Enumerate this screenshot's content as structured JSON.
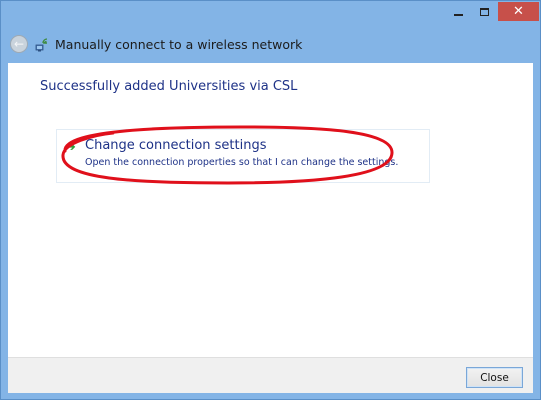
{
  "window": {
    "controls": {
      "minimize_icon": "minimize-icon",
      "maximize_icon": "maximize-icon",
      "close_glyph": "✕"
    }
  },
  "header": {
    "back_glyph": "←",
    "title": "Manually connect to a wireless network",
    "icon": "wireless-network-icon"
  },
  "main": {
    "success_message": "Successfully added Universities via CSL",
    "option": {
      "arrow_glyph": "➔",
      "title": "Change connection settings",
      "description": "Open the connection properties so that I can change the settings."
    },
    "highlight_color": "#e0101b"
  },
  "footer": {
    "close_label": "Close"
  },
  "colors": {
    "frame": "#83b4e6",
    "link_text": "#1e3287",
    "arrow": "#2e9d3a",
    "close_button": "#c7504a"
  }
}
